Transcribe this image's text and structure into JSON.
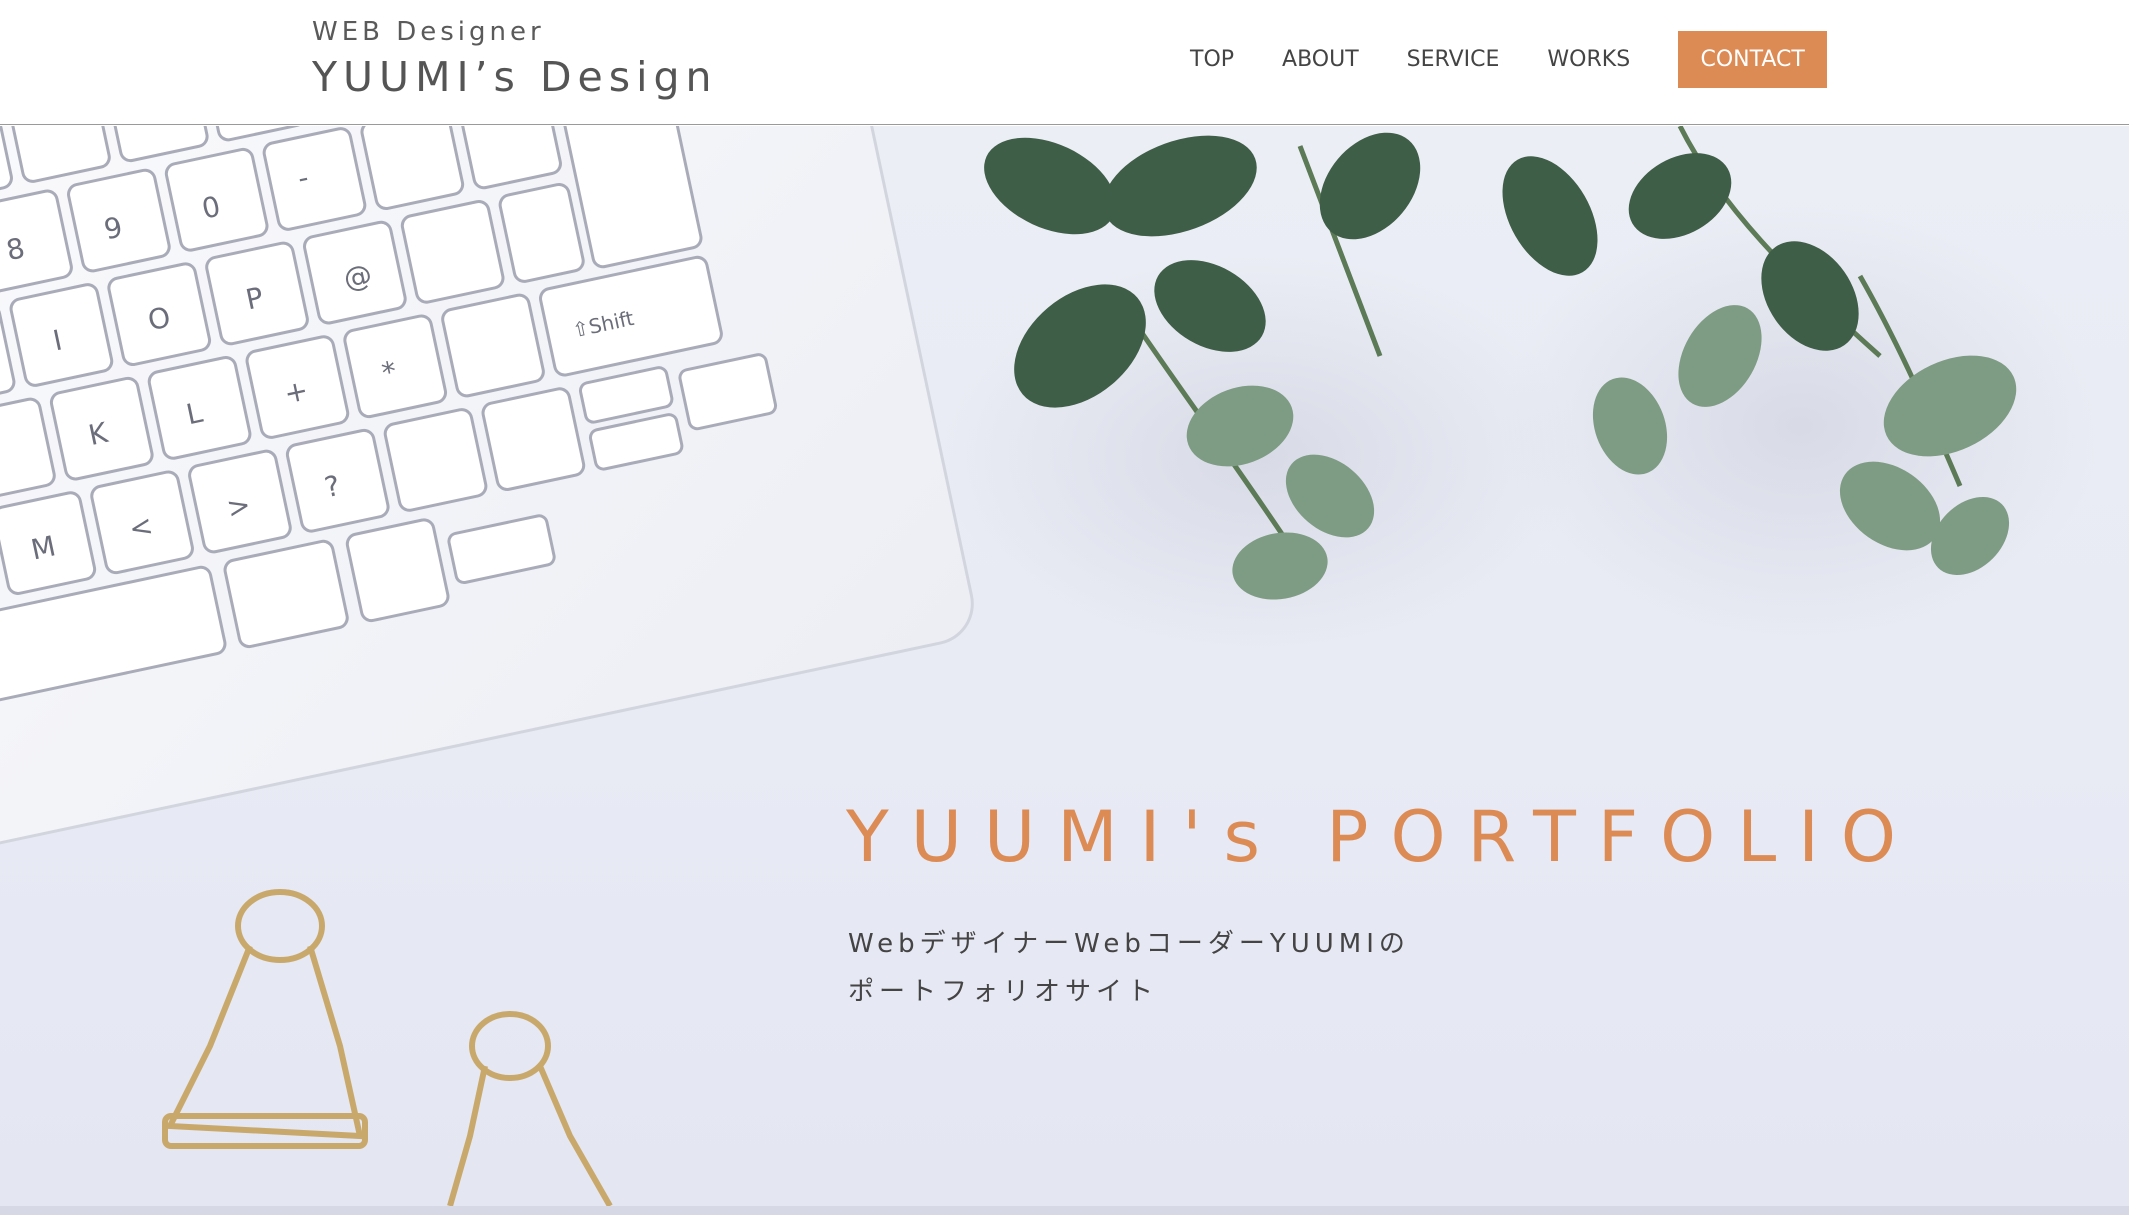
{
  "header": {
    "brand_sub": "WEB Designer",
    "brand_title": "YUUMI’s Design",
    "nav": [
      "TOP",
      "ABOUT",
      "SERVICE",
      "WORKS"
    ],
    "contact_label": "CONTACT"
  },
  "hero": {
    "title": "YUUMI's PORTFOLIO",
    "desc_line1": "WebデザイナーWebコーダーYUUMIの",
    "desc_line2": "ポートフォリオサイト"
  },
  "colors": {
    "accent": "#dd8b55",
    "hero_bg": "#e8eaf4",
    "text": "#444444"
  }
}
